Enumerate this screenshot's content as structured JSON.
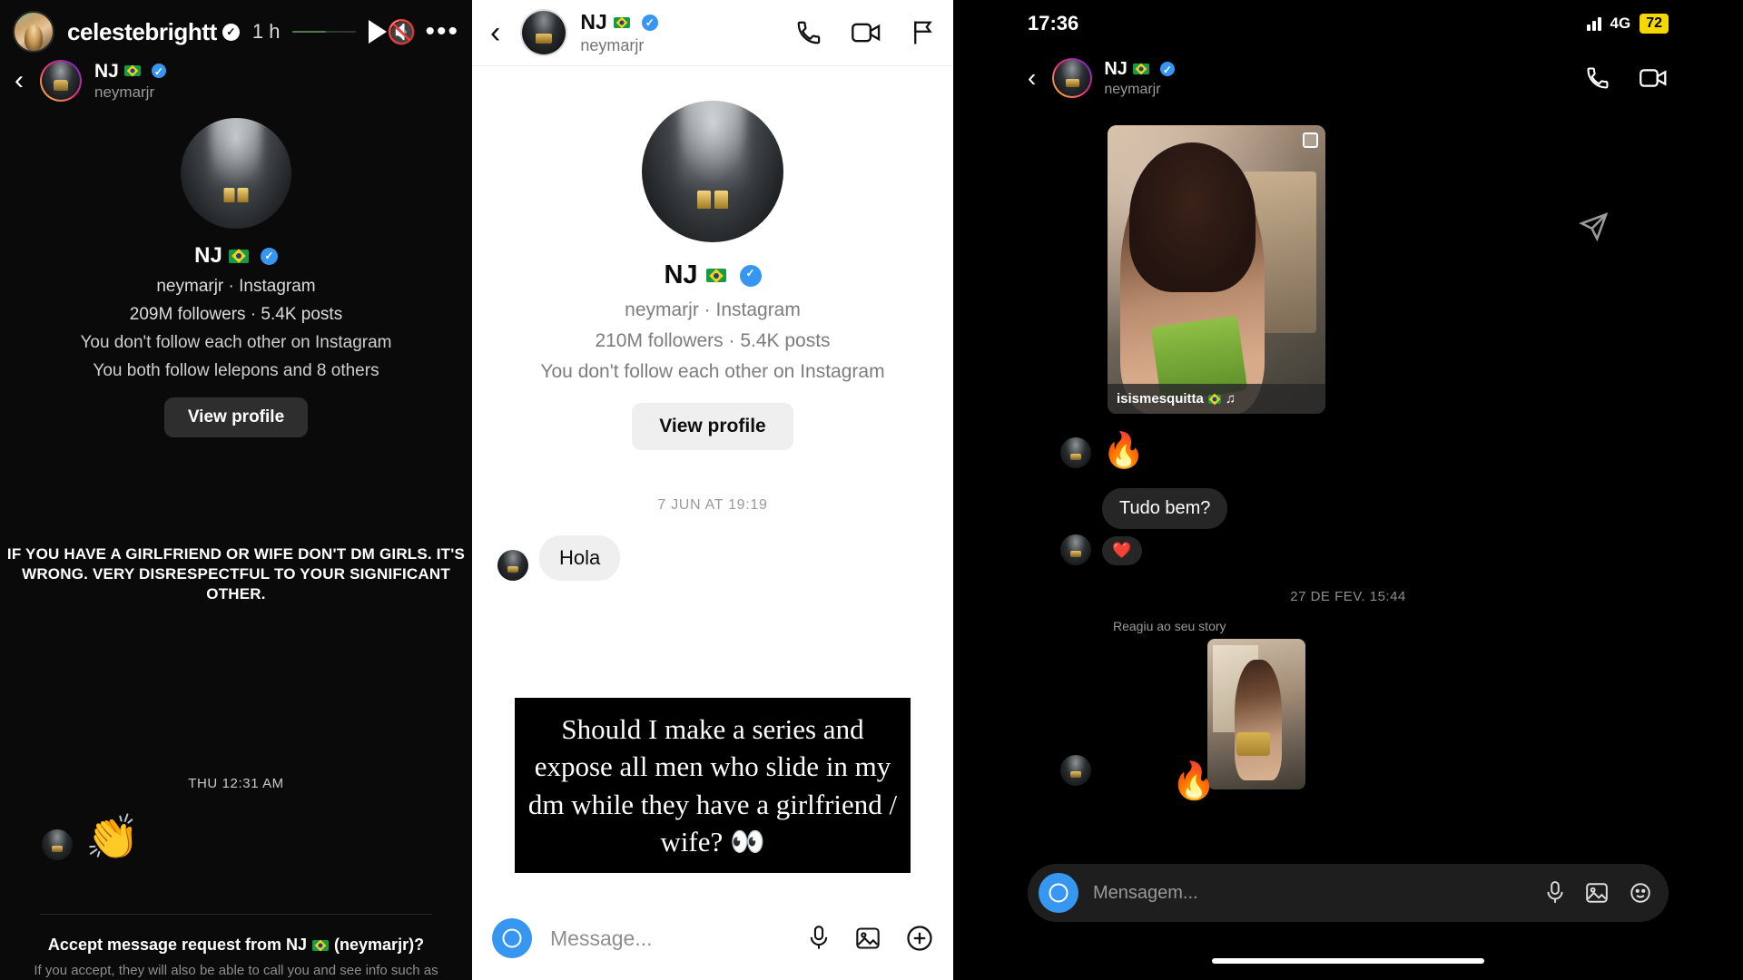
{
  "panel1": {
    "story": {
      "username": "celestebrightt",
      "verified_icon": "verified-badge-white",
      "time": "1 h",
      "play_icon": "play-icon",
      "mute_icon": "mute-icon",
      "more_icon": "more-options-icon"
    },
    "dm_header": {
      "back_icon": "back-chevron-icon",
      "name": "NJ",
      "flag_icon": "brazil-flag-icon",
      "verified_icon": "verified-badge-icon",
      "handle": "neymarjr"
    },
    "profile": {
      "name": "NJ",
      "flag_icon": "brazil-flag-icon",
      "verified_icon": "verified-badge-icon",
      "handle_line": "neymarjr · Instagram",
      "stats_line": "209M followers · 5.4K posts",
      "follow_line": "You don't follow each other on Instagram",
      "mutual_line": "You both follow lelepons and 8 others",
      "view_profile_label": "View profile"
    },
    "overlay_text": "IF YOU HAVE A GIRLFRIEND OR WIFE DON'T DM GIRLS. IT'S WRONG. VERY DISRESPECTFUL TO YOUR SIGNIFICANT OTHER.",
    "daystamp": "THU 12:31 AM",
    "reaction_emoji": "👏",
    "accept_text": "Accept message request from NJ",
    "accept_text_suffix": "(neymarjr)?",
    "accept_sub": "If you accept, they will also be able to call you and see info such as"
  },
  "panel2": {
    "header": {
      "back_icon": "back-chevron-icon",
      "name": "NJ",
      "flag_icon": "brazil-flag-icon",
      "verified_icon": "verified-badge-icon",
      "handle": "neymarjr",
      "call_icon": "phone-call-icon",
      "video_icon": "video-call-icon",
      "flag_report_icon": "flag-report-icon"
    },
    "profile": {
      "name": "NJ",
      "flag_icon": "brazil-flag-icon",
      "verified_icon": "verified-badge-icon",
      "handle_line": "neymarjr · Instagram",
      "stats_line": "210M followers · 5.4K posts",
      "follow_line": "You don't follow each other on Instagram",
      "view_profile_label": "View profile"
    },
    "timestamp": "7 JUN AT 19:19",
    "message": "Hola",
    "quote_text": "Should I make a series and expose all men who slide in my dm while they have a girlfriend / wife? 👀",
    "input": {
      "camera_icon": "camera-icon",
      "placeholder": "Message...",
      "mic_icon": "microphone-icon",
      "gallery_icon": "gallery-icon",
      "plus_icon": "plus-circle-icon"
    }
  },
  "panel3": {
    "status": {
      "time": "17:36",
      "signal_icon": "signal-bars-icon",
      "network": "4G",
      "battery": "72"
    },
    "header": {
      "back_icon": "back-chevron-icon",
      "name": "NJ",
      "flag_icon": "brazil-flag-icon",
      "verified_icon": "verified-badge-icon",
      "handle": "neymarjr",
      "call_icon": "phone-call-icon",
      "video_icon": "video-call-icon"
    },
    "shared_post": {
      "tag_label": "isismesquitta",
      "multi_icon": "multi-photo-icon",
      "share_icon": "share-arrow-icon"
    },
    "messages": [
      {
        "type": "emoji",
        "value": "🔥"
      },
      {
        "type": "text",
        "value": "Tudo bem?"
      },
      {
        "type": "reaction",
        "value": "❤️"
      }
    ],
    "timestamp": "27 DE FEV. 15:44",
    "reacted_label": "Reagiu ao seu story",
    "second_reaction": "🔥",
    "input": {
      "camera_icon": "camera-icon",
      "placeholder": "Mensagem...",
      "mic_icon": "microphone-icon",
      "gallery_icon": "gallery-icon",
      "sticker_icon": "sticker-icon"
    }
  },
  "colors": {
    "accent_blue": "#3797f0",
    "dark_bg": "#000000",
    "light_bg": "#ffffff",
    "bubble_light": "#efefef",
    "bubble_dark": "#262626",
    "battery_yellow": "#f5d800"
  }
}
